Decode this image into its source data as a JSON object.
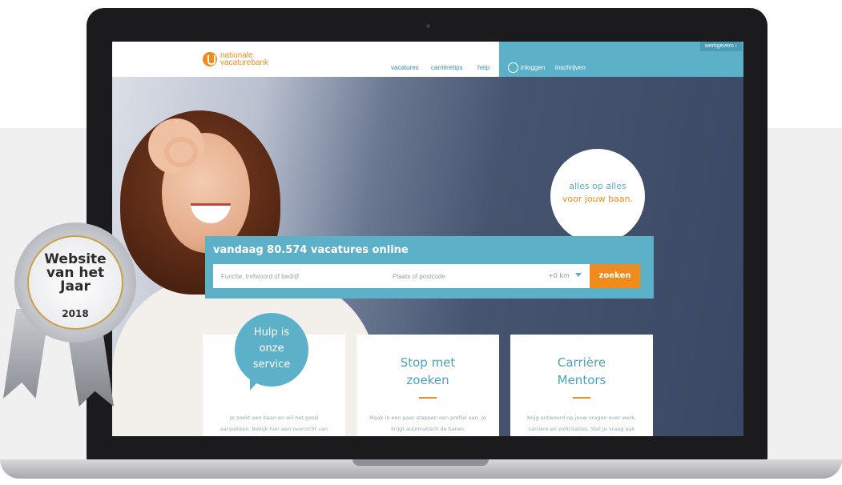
{
  "site": {
    "logo_line1": "nationale",
    "logo_line2": "vacaturebank",
    "werkgevers": "werkgevers ›"
  },
  "nav": {
    "vacatures": "vacatures",
    "carrieretips": "carrièretips",
    "help": "help",
    "inloggen": "inloggen",
    "inschrijven": "inschrijven"
  },
  "hero": {
    "bubble_line1": "alles op alles",
    "bubble_line2": "voor jouw baan."
  },
  "search": {
    "title": "vandaag 80.574 vacatures online",
    "keyword_placeholder": "Functie, trefwoord of bedrijf",
    "location_placeholder": "Plaats of postcode",
    "radius": "+0 km",
    "button": "zoeken"
  },
  "cards": [
    {
      "title": "",
      "text": "Je zoekt een baan en wil het goed aanpakken. Bekijk hier een overzicht van"
    },
    {
      "title": "Stop met zoeken",
      "text": "Maak in een paar stappen een profiel aan. Je krijgt automatisch de banen"
    },
    {
      "title": "Carrière Mentors",
      "text": "Krijg antwoord op jouw vragen over werk, carrière en sollicitaties. Stel je vraag aan"
    }
  ],
  "help_bubble": "Hulp is onze service",
  "badge": {
    "line1": "Website",
    "line2": "van het",
    "line3": "Jaar",
    "year": "2018"
  },
  "colors": {
    "teal": "#5cb0c8",
    "orange": "#f08c1e",
    "hero_dark": "#3e4d69"
  }
}
